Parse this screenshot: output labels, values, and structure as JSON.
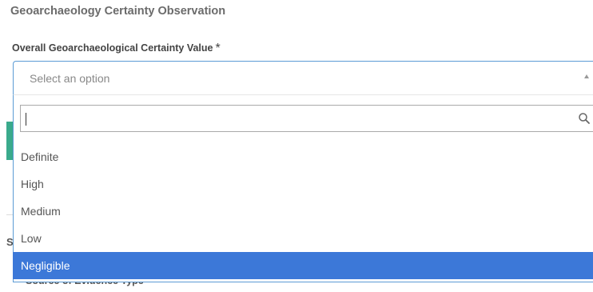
{
  "section": {
    "title": "Geoarchaeology Certainty Observation"
  },
  "field": {
    "label": "Overall Geoarchaeological Certainty Value",
    "required_marker": "*",
    "placeholder": "Select an option"
  },
  "dropdown": {
    "search_value": "",
    "options": [
      "Definite",
      "High",
      "Medium",
      "Low",
      "Negligible"
    ],
    "highlighted_option": "Negligible"
  },
  "background": {
    "partial_letter": "S",
    "next_field_label": "Source of Evidence Type"
  },
  "colors": {
    "focus_border": "#5b9bd5",
    "highlight": "#3c78d8",
    "accent_bar": "#3aaa8c"
  },
  "icons": {
    "search": "search-icon",
    "arrow": "chevron-up-icon"
  }
}
